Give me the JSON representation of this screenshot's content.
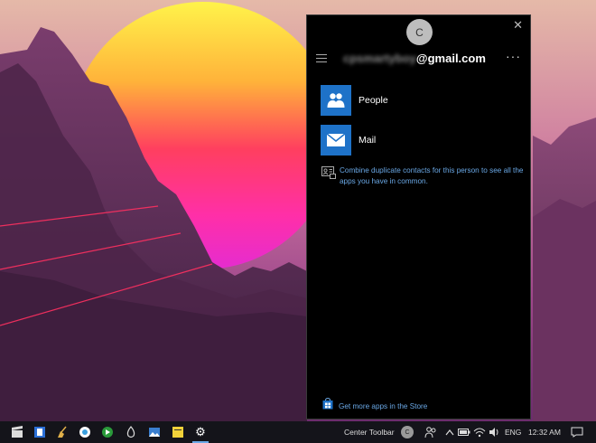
{
  "panel": {
    "avatar_letter": "C",
    "close_glyph": "✕",
    "email_user": "cpsmartyboy",
    "email_domain": "@gmail.com",
    "more_glyph": "···",
    "apps": [
      {
        "label": "People",
        "icon": "people-icon"
      },
      {
        "label": "Mail",
        "icon": "mail-icon"
      }
    ],
    "notice": "Combine duplicate contacts for this person to see all the apps you have in common.",
    "store_link": "Get more apps in the Store"
  },
  "taskbar": {
    "toolbar_label": "Center Toolbar",
    "avatar_letter": "C",
    "language": "ENG",
    "time": "12:32 AM"
  },
  "colors": {
    "accent": "#1e72c8",
    "link": "#6aa8e6",
    "panel_bg": "#000000",
    "taskbar_bg": "#14141a"
  }
}
